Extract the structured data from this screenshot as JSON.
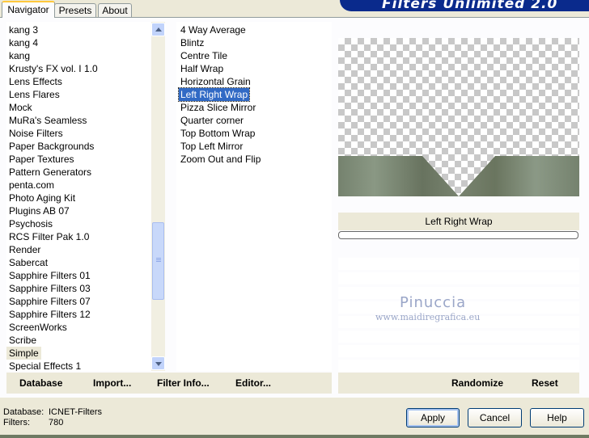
{
  "tabs": [
    {
      "label": "Navigator",
      "active": true
    },
    {
      "label": "Presets",
      "active": false
    },
    {
      "label": "About",
      "active": false
    }
  ],
  "banner": {
    "title": "Filters Unlimited 2.0",
    "color": "#0a2a8c"
  },
  "categories": [
    "kang 3",
    "kang 4",
    "kang",
    "Krusty's FX vol. I 1.0",
    "Lens Effects",
    "Lens Flares",
    "Mock",
    "MuRa's Seamless",
    "Noise Filters",
    "Paper Backgrounds",
    "Paper Textures",
    "Pattern Generators",
    "penta.com",
    "Photo Aging Kit",
    "Plugins AB 07",
    "Psychosis",
    "RCS Filter Pak 1.0",
    "Render",
    "Sabercat",
    "Sapphire Filters 01",
    "Sapphire Filters 03",
    "Sapphire Filters 07",
    "Sapphire Filters 12",
    "ScreenWorks",
    "Scribe",
    "Simple",
    "Special Effects 1"
  ],
  "selected_category": "Simple",
  "filters": [
    "4 Way Average",
    "Blintz",
    "Centre Tile",
    "Half Wrap",
    "Horizontal Grain",
    "Left Right Wrap",
    "Pizza Slice Mirror",
    "Quarter corner",
    "Top Bottom Wrap",
    "Top Left Mirror",
    "Zoom Out and Flip"
  ],
  "selected_filter": "Left Right Wrap",
  "preview": {
    "filter_name": "Left Right Wrap"
  },
  "watermark": {
    "name": "Pinuccia",
    "url": "www.maidiregrafica.eu"
  },
  "left_actions": {
    "database": "Database",
    "import": "Import...",
    "filter_info": "Filter Info...",
    "editor": "Editor..."
  },
  "right_actions": {
    "randomize": "Randomize",
    "reset": "Reset"
  },
  "status": {
    "database_label": "Database:",
    "database_value": "ICNET-Filters",
    "filters_label": "Filters:",
    "filters_value": "780"
  },
  "buttons": {
    "apply": "Apply",
    "cancel": "Cancel",
    "help": "Help"
  },
  "icons": [
    "scroll-up-arrow-icon",
    "scroll-down-arrow-icon",
    "scroll-thumb-grip-icon"
  ]
}
